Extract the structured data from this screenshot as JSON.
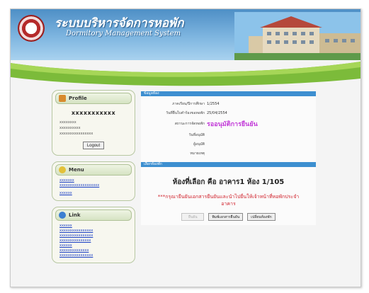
{
  "header": {
    "title_th": "ระบบบริหารจัดการหอพัก",
    "title_en": "Dormitory Management System"
  },
  "profile": {
    "title": "Profile",
    "username": "xxxxxxxxxxx",
    "lines": [
      "xxxxxxxx",
      "xxxxxxxxxx",
      "xxxxxxxxxxxxxxxx"
    ],
    "logout_label": "Logout"
  },
  "menu": {
    "title": "Menu",
    "links": [
      "xxxxxxx",
      "xxxxxxxxxxxxxxxxxxx",
      "xxxxxx"
    ]
  },
  "links_panel": {
    "title": "Link",
    "links": [
      "xxxxxx",
      "xxxxxxxxxxxxxxxx",
      "xxxxxxxxxxxxxxxx",
      "xxxxxxxxxxxxxxx",
      "xxxxxx",
      "xxxxxxxxxxxxxx",
      "xxxxxxxxxxxxxxxx"
    ]
  },
  "main": {
    "section1_title": "ข้อมูลห้อง",
    "rows": [
      {
        "label": "ภาคเรียน/ปีการศึกษา",
        "value": "1/2554"
      },
      {
        "label": "วันที่ยื่นใบคำร้องขอหอพัก",
        "value": "25/04/2554"
      },
      {
        "label": "สถานะการจัดหอพัก",
        "value": "รออนุมัติการยืนยัน"
      },
      {
        "label": "วันที่อนุมัติ",
        "value": ""
      },
      {
        "label": "ผู้อนุมัติ",
        "value": ""
      },
      {
        "label": "หมายเหตุ",
        "value": ""
      }
    ],
    "section2_title": "เลือกห้องพัก",
    "room_text": "ห้องที่เลือก คือ อาคาร1 ห้อง 1/105",
    "warning": "***กรุณายืนยันเอกสารยืนยันและนำไปยื่นให้เจ้าหน้าที่หอพักประจำอาคาร",
    "buttons": {
      "confirm": "ยืนยัน",
      "print": "พิมพ์เอกสารยืนยัน",
      "change": "เปลี่ยนห้องพัก"
    }
  },
  "colors": {
    "section_bar": "#3d8fd0",
    "status_text": "#c23ad8",
    "warning_text": "#d0202a",
    "link": "#1a3fc4"
  }
}
